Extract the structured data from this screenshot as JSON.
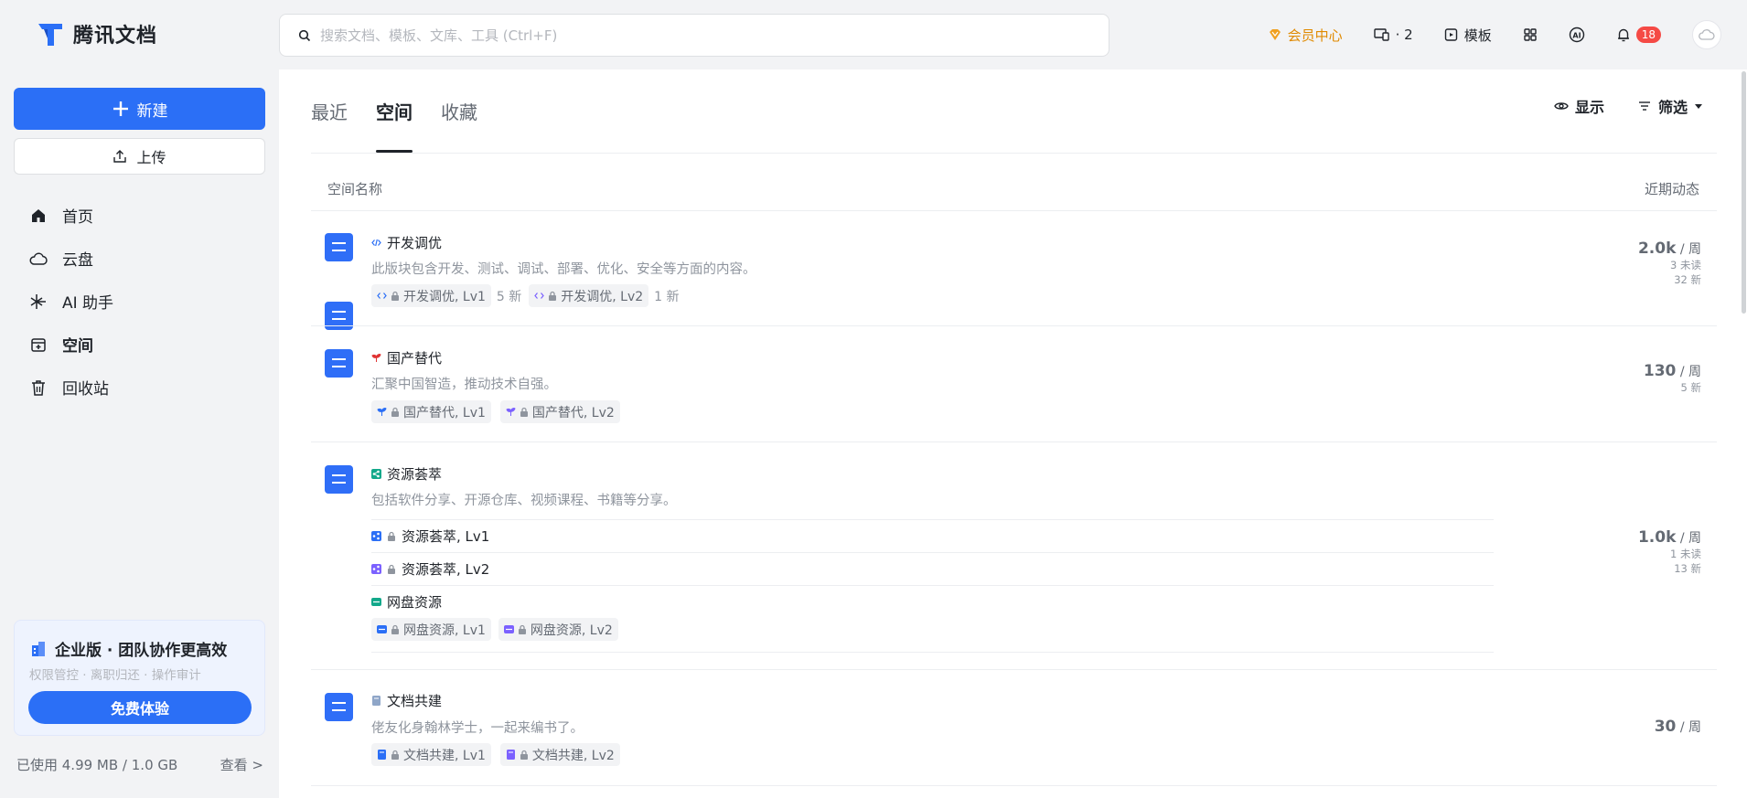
{
  "app": {
    "name": "腾讯文档"
  },
  "search": {
    "placeholder": "搜索文档、模板、文库、工具 (Ctrl+F)"
  },
  "topbar": {
    "vip_label": "会员中心",
    "devices_label": "· 2",
    "templates_label": "模板",
    "notifications_count": "18"
  },
  "sidebar": {
    "new_label": "新建",
    "upload_label": "上传",
    "items": [
      {
        "label": "首页",
        "icon": "home-icon"
      },
      {
        "label": "云盘",
        "icon": "cloud-icon"
      },
      {
        "label": "AI 助手",
        "icon": "ai-assistant-icon"
      },
      {
        "label": "空间",
        "icon": "space-icon",
        "active": true
      },
      {
        "label": "回收站",
        "icon": "trash-icon"
      }
    ],
    "promo": {
      "title": "企业版 · 团队协作更高效",
      "subtitle": "权限管控 · 离职归还 · 操作审计",
      "button": "免费体验"
    },
    "storage": {
      "used": "已使用 4.99 MB / 1.0 GB",
      "view": "查看 >"
    }
  },
  "main": {
    "tabs": [
      {
        "label": "最近"
      },
      {
        "label": "空间",
        "active": true
      },
      {
        "label": "收藏"
      }
    ],
    "display_label": "显示",
    "filter_label": "筛选",
    "col_name": "空间名称",
    "col_activity": "近期动态",
    "spaces": [
      {
        "title": "开发调优",
        "desc": "此版块包含开发、测试、调试、部署、优化、安全等方面的内容。",
        "chips": [
          {
            "label": "开发调优, Lv1",
            "new": "5 新"
          },
          {
            "label": "开发调优, Lv2",
            "new": "1 新"
          }
        ],
        "stat_num": "2.0k",
        "stat_unit": "/ 周",
        "unread": "3 未读",
        "new": "32 新"
      },
      {
        "title": "国产替代",
        "desc": "汇聚中国智造，推动技术自强。",
        "chips": [
          {
            "label": "国产替代, Lv1"
          },
          {
            "label": "国产替代, Lv2"
          }
        ],
        "stat_num": "130",
        "stat_unit": "/ 周",
        "new": "5 新"
      },
      {
        "title": "资源荟萃",
        "desc": "包括软件分享、开源仓库、视频课程、书籍等分享。",
        "sub": [
          {
            "label": "资源荟萃, Lv1"
          },
          {
            "label": "资源荟萃, Lv2"
          },
          {
            "label": "网盘资源"
          }
        ],
        "chips": [
          {
            "label": "网盘资源, Lv1"
          },
          {
            "label": "网盘资源, Lv2"
          }
        ],
        "stat_num": "1.0k",
        "stat_unit": "/ 周",
        "unread": "1 未读",
        "new": "13 新"
      },
      {
        "title": "文档共建",
        "desc": "佬友化身翰林学士，一起来编书了。",
        "chips": [
          {
            "label": "文档共建, Lv1"
          },
          {
            "label": "文档共建, Lv2"
          }
        ],
        "stat_num": "30",
        "stat_unit": "/ 周"
      }
    ]
  },
  "colors": {
    "accent": "#2b6ff6",
    "vip": "#e08a00",
    "badge": "#f54a45"
  }
}
